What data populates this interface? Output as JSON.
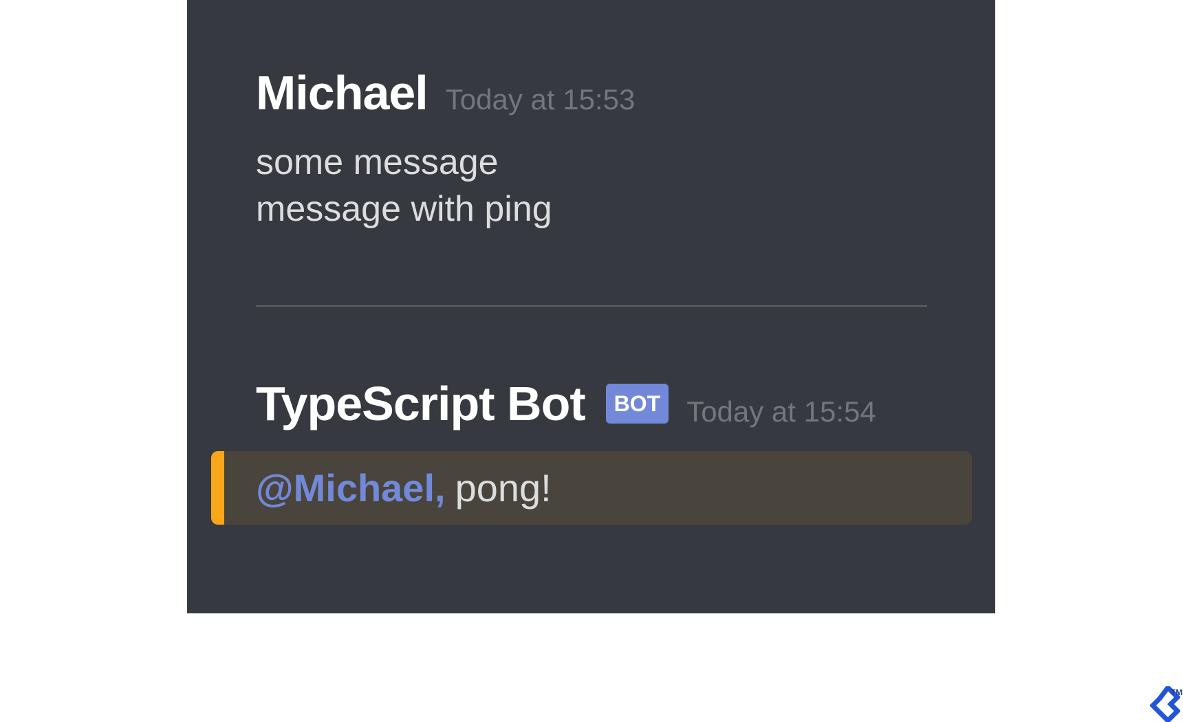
{
  "messages": [
    {
      "author": "Michael",
      "timestamp": "Today at 15:53",
      "lines": [
        "some message",
        "message with ping"
      ]
    },
    {
      "author": "TypeScript Bot",
      "badge": "BOT",
      "timestamp": "Today at 15:54",
      "mention": "@Michael,",
      "text": "pong!"
    }
  ],
  "colors": {
    "panel_bg": "#36393f",
    "mention": "#7289da",
    "highlight_bar": "#faa61a",
    "highlight_bg": "#49443c",
    "badge_bg": "#7289da"
  },
  "watermark": {
    "icon": "toptal-logo-icon",
    "trademark": "TM"
  }
}
